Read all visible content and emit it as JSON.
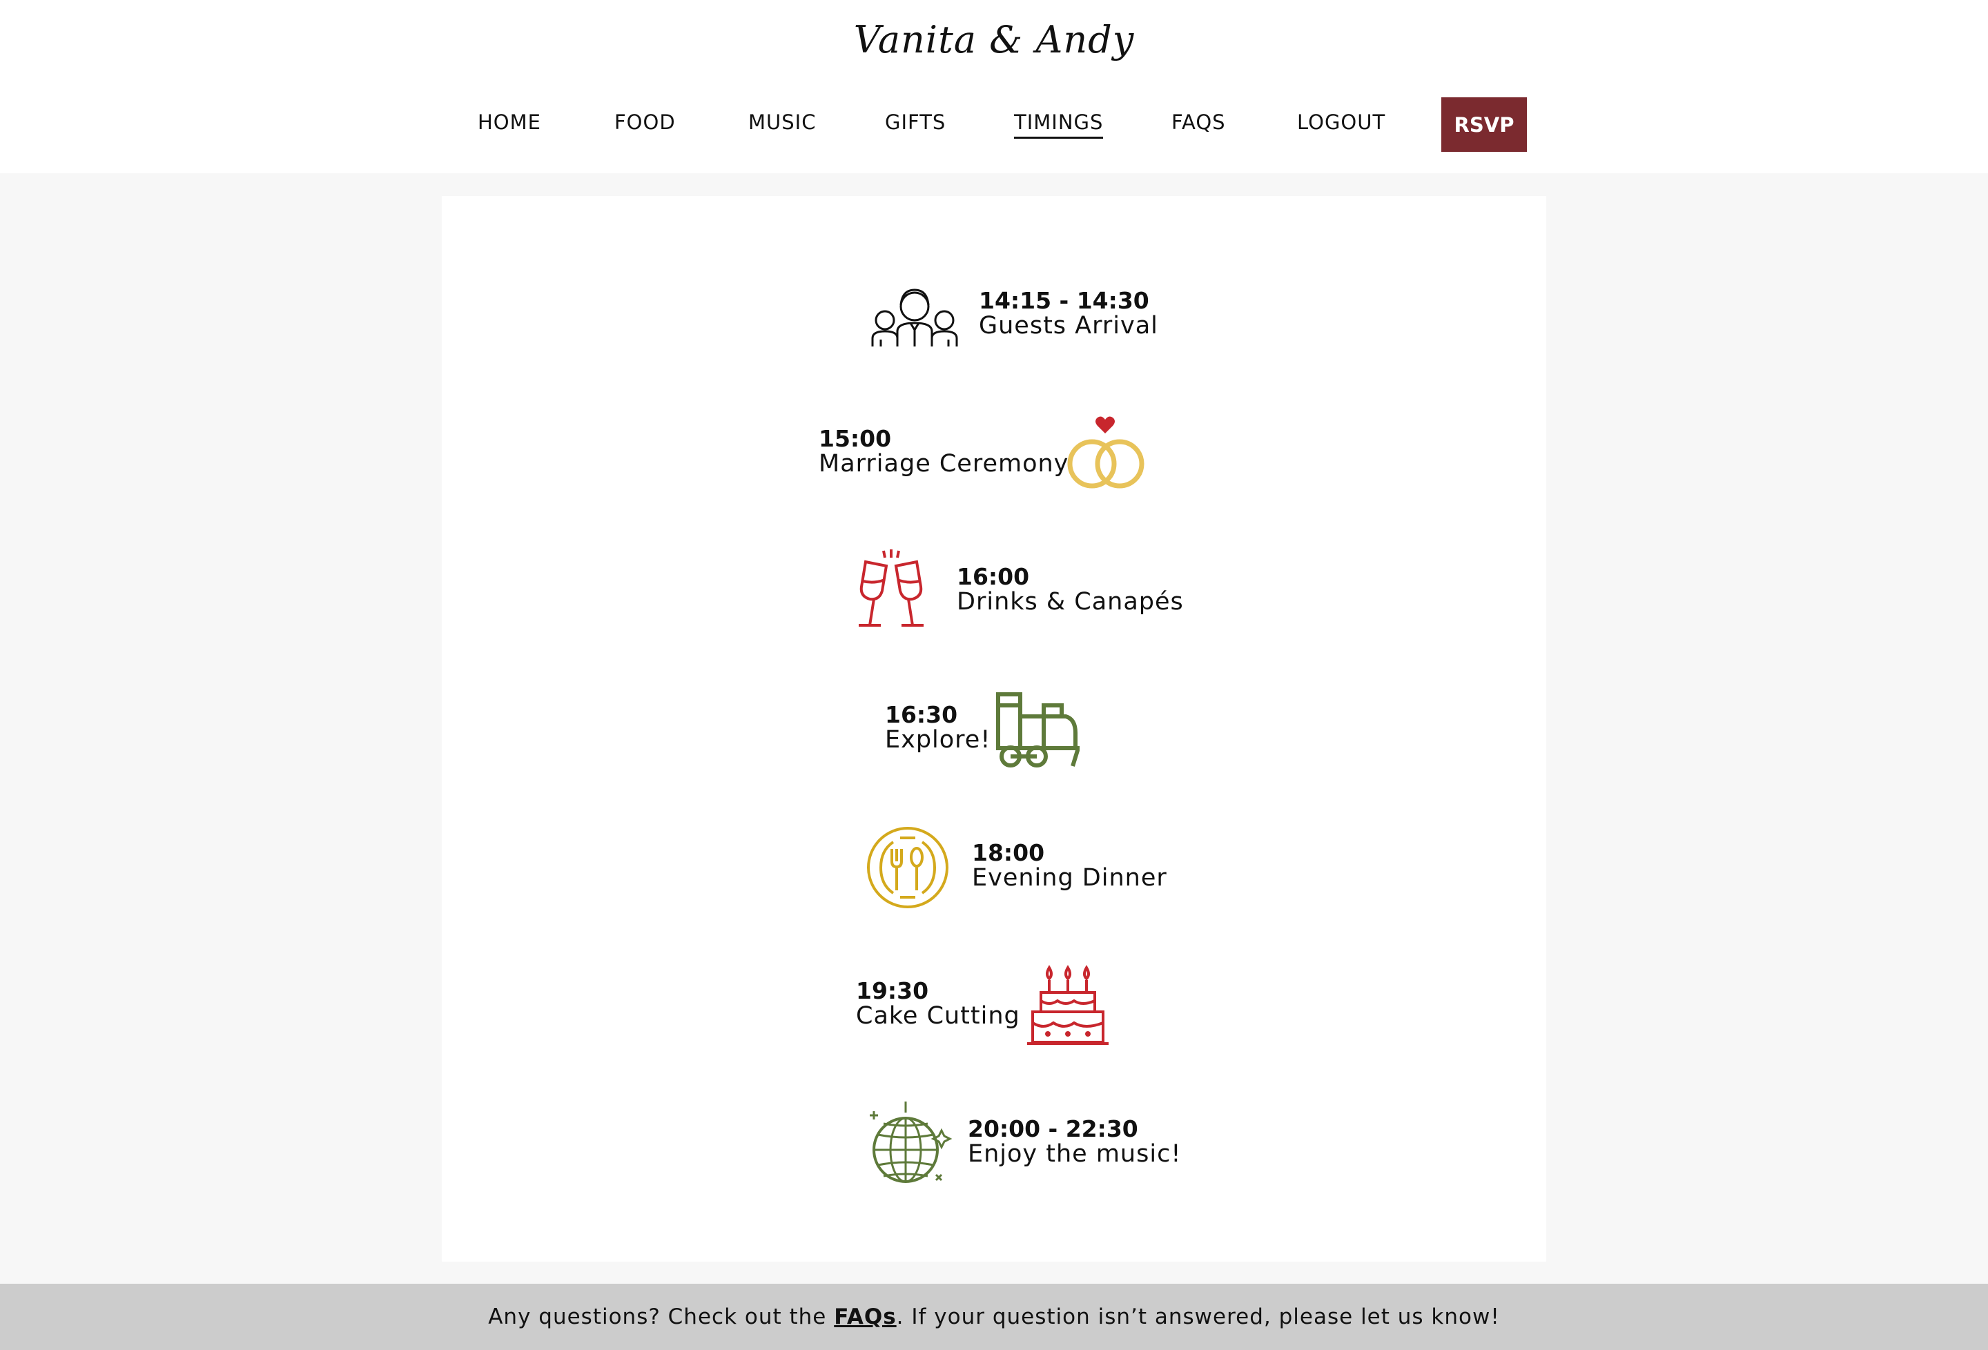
{
  "header": {
    "site_title": "Vanita & Andy",
    "nav": [
      "HOME",
      "FOOD",
      "MUSIC",
      "GIFTS",
      "TIMINGS",
      "FAQS",
      "LOGOUT"
    ],
    "active_nav": "TIMINGS",
    "rsvp_label": "RSVP"
  },
  "timeline": [
    {
      "time": "14:15 - 14:30",
      "label": "Guests Arrival",
      "icon": "guests-icon"
    },
    {
      "time": "15:00",
      "label": "Marriage Ceremony",
      "icon": "rings-icon"
    },
    {
      "time": "16:00",
      "label": "Drinks & Canapés",
      "icon": "champagne-glasses-icon"
    },
    {
      "time": "16:30",
      "label": "Explore!",
      "icon": "train-icon"
    },
    {
      "time": "18:00",
      "label": "Evening Dinner",
      "icon": "plate-cutlery-icon"
    },
    {
      "time": "19:30",
      "label": "Cake Cutting",
      "icon": "cake-icon"
    },
    {
      "time": "20:00 - 22:30",
      "label": "Enjoy the music!",
      "icon": "disco-ball-icon"
    }
  ],
  "footer": {
    "text_before": "Any questions? Check out the ",
    "link_label": "FAQs",
    "text_after": ". If your question isn’t answered, please let us know!"
  },
  "colors": {
    "accent": "#7b2a2f",
    "red_icon": "#c8262d",
    "gold_icon": "#e8c35a",
    "green_icon": "#5e7a3a",
    "mustard_icon": "#d4a91c",
    "background": "#f7f7f7",
    "footer_bg": "#cccccc"
  }
}
